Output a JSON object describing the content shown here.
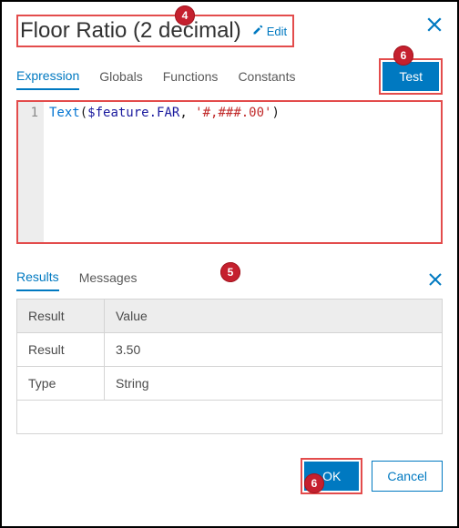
{
  "header": {
    "title": "Floor Ratio (2 decimal)",
    "edit_label": "Edit"
  },
  "tabs": {
    "expression": "Expression",
    "globals": "Globals",
    "functions": "Functions",
    "constants": "Constants",
    "test_label": "Test"
  },
  "code": {
    "line_no": "1",
    "fn": "Text",
    "open": "(",
    "var": "$feature.FAR",
    "comma": ", ",
    "str": "'#,###.00'",
    "close": ")"
  },
  "results": {
    "tab_results": "Results",
    "tab_messages": "Messages",
    "col_result": "Result",
    "col_value": "Value",
    "rows": [
      {
        "k": "Result",
        "v": "3.50"
      },
      {
        "k": "Type",
        "v": "String"
      }
    ]
  },
  "footer": {
    "ok": "OK",
    "cancel": "Cancel"
  },
  "callouts": {
    "c4": "4",
    "c5": "5",
    "c6a": "6",
    "c6b": "6"
  }
}
